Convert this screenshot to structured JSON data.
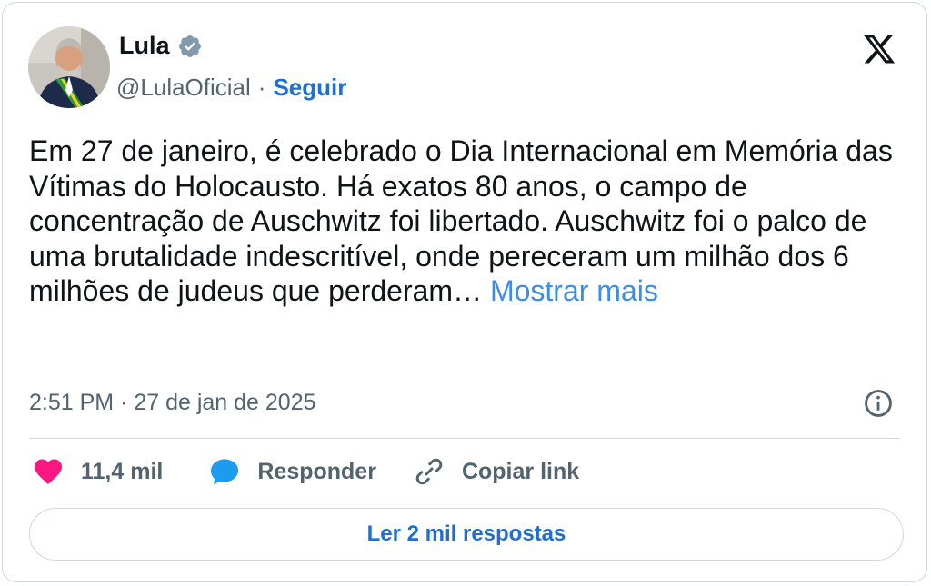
{
  "author": {
    "name": "Lula",
    "handle": "@LulaOficial",
    "separator": "·",
    "follow_label": "Seguir",
    "verified_icon": "verified-badge-icon"
  },
  "tweet": {
    "text": "Em 27 de janeiro, é celebrado o Dia Internacional em Memória das Vítimas do Holocausto. Há exatos 80 anos, o campo de concentração de Auschwitz foi libertado. Auschwitz foi o palco de uma brutalidade indescritível, onde pereceram um milhão dos 6 milhões de judeus que perderam…",
    "show_more": "Mostrar mais",
    "timestamp": "2:51 PM · 27 de jan de 2025"
  },
  "actions": {
    "like_count": "11,4 mil",
    "reply_label": "Responder",
    "copy_link_label": "Copiar link"
  },
  "read_replies_label": "Ler 2 mil respostas",
  "colors": {
    "accent": "#1d6fd6",
    "link": "#3b8de6",
    "heart": "#f91880",
    "reply_bubble": "#1d9bf0",
    "border": "#cfd9de",
    "muted": "#536471"
  }
}
